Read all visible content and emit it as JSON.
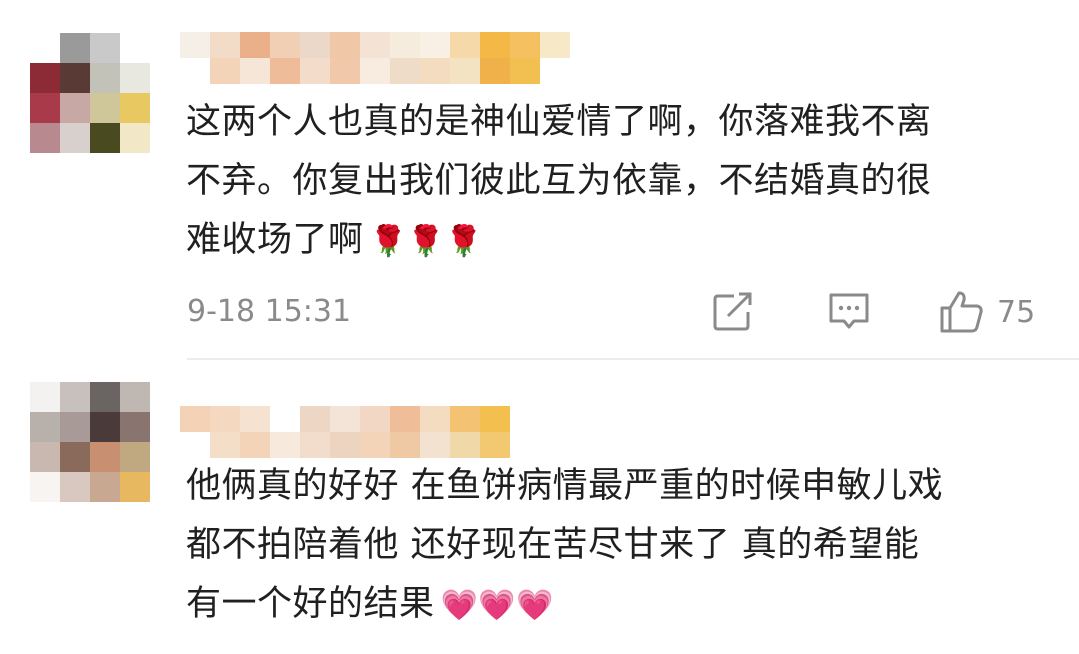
{
  "comments": [
    {
      "text": "这两个人也真的是神仙爱情了啊，你落难我不离\n不弃。你复出我们彼此互为依靠，不结婚真的很\n难收场了啊",
      "emoji": "🌹🌹🌹",
      "timestamp": "9-18 15:31",
      "like_count": "75"
    },
    {
      "text": "他俩真的好好 在鱼饼病情最严重的时候申敏儿戏\n都不拍陪着他 还好现在苦尽甘来了 真的希望能\n有一个好的结果",
      "emoji": "💗💗💗"
    }
  ],
  "icons": {
    "share": "share-icon",
    "reply": "comment-icon",
    "like": "thumbs-up-icon"
  },
  "colors": {
    "text": "#202020",
    "meta": "#8a8a8a",
    "divider": "#ececec"
  }
}
